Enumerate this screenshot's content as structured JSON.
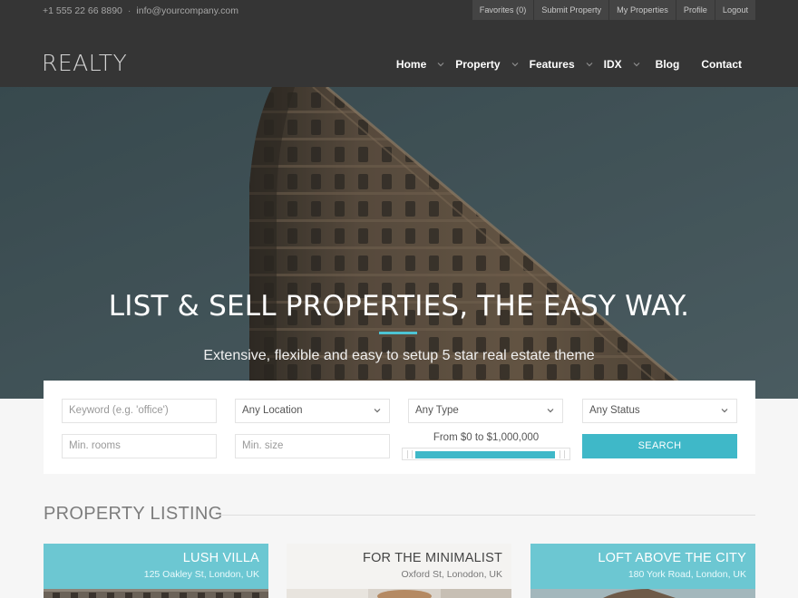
{
  "topbar": {
    "phone": "+1 555 22 66 8890",
    "separator": "·",
    "email": "info@yourcompany.com",
    "account_links": [
      "Favorites (0)",
      "Submit Property",
      "My Properties",
      "Profile",
      "Logout"
    ]
  },
  "brand": {
    "logo": "REALTY"
  },
  "nav": {
    "items": [
      {
        "label": "Home",
        "icon": "chevron-down-icon"
      },
      {
        "label": "Property",
        "icon": "chevron-down-icon"
      },
      {
        "label": "Features",
        "icon": "chevron-down-icon"
      },
      {
        "label": "IDX",
        "icon": "chevron-down-icon"
      },
      {
        "label": "Blog"
      },
      {
        "label": "Contact"
      }
    ]
  },
  "hero": {
    "title": "LIST & SELL PROPERTIES, THE EASY WAY.",
    "subtitle": "Extensive, flexible and easy to setup 5 star real estate theme"
  },
  "search": {
    "keyword_placeholder": "Keyword (e.g. 'office')",
    "location_selected": "Any Location",
    "type_selected": "Any Type",
    "status_selected": "Any Status",
    "rooms_placeholder": "Min. rooms",
    "size_placeholder": "Min. size",
    "price_range_label": "From $0 to $1,000,000",
    "price_min": 0,
    "price_max": 1000000,
    "button_label": "SEARCH"
  },
  "listing": {
    "section_title": "PROPERTY LISTING",
    "cards": [
      {
        "title": "LUSH VILLA",
        "address": "125 Oakley St, London, UK"
      },
      {
        "title": "FOR THE MINIMALIST",
        "address": "Oxford St, Lonodon, UK"
      },
      {
        "title": "LOFT ABOVE THE CITY",
        "address": "180 York Road, London, UK"
      }
    ]
  },
  "colors": {
    "accent": "#3fb8c8",
    "header_bg": "#353535",
    "page_bg": "#f6f6f6"
  }
}
